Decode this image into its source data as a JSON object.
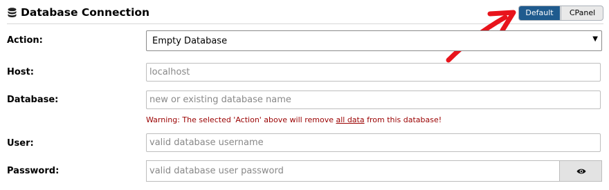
{
  "header": {
    "title": "Database Connection",
    "icon": "database-icon"
  },
  "mode_toggle": {
    "default_label": "Default",
    "cpanel_label": "CPanel",
    "selected": "Default",
    "active_color": "#1f5b8e"
  },
  "annotation": {
    "icon": "red-arrow-icon",
    "color": "#e8141c"
  },
  "form": {
    "action": {
      "label": "Action:",
      "value": "Empty Database"
    },
    "host": {
      "label": "Host:",
      "placeholder": "localhost"
    },
    "database": {
      "label": "Database:",
      "placeholder": "new or existing database name"
    },
    "warning": {
      "prefix": "Warning: The selected 'Action' above will remove ",
      "emphasis": "all data",
      "suffix": " from this database!"
    },
    "user": {
      "label": "User:",
      "placeholder": "valid database username"
    },
    "password": {
      "label": "Password:",
      "placeholder": "valid database user password",
      "toggle_icon": "eye-icon"
    }
  }
}
